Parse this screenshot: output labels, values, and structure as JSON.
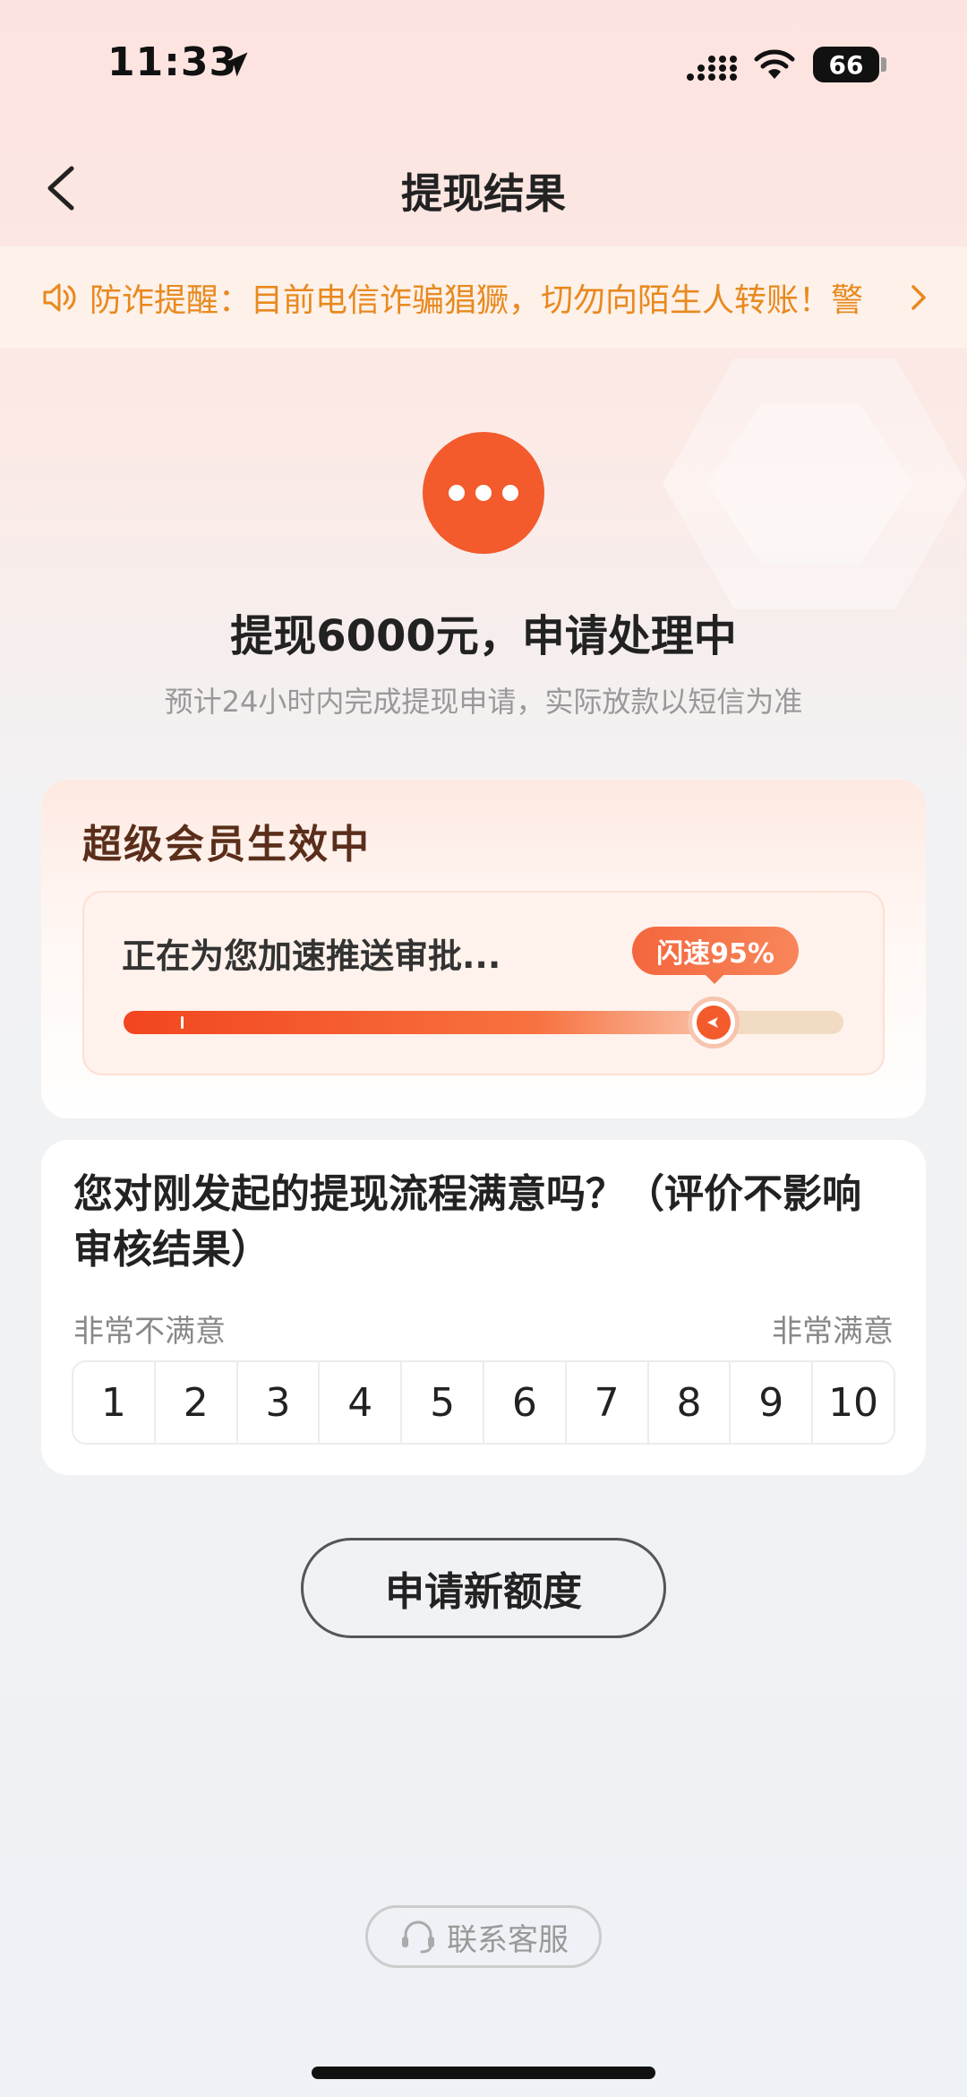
{
  "status_bar": {
    "time": "11:33",
    "battery": "66"
  },
  "nav": {
    "title": "提现结果"
  },
  "notice": {
    "text": "防诈提醒：目前电信诈骗猖獗，切勿向陌生人转账！警"
  },
  "result": {
    "title": "提现6000元，申请处理中",
    "subtitle": "预计24小时内完成提现申请，实际放款以短信为准"
  },
  "member": {
    "title": "超级会员生效中",
    "push_text": "正在为您加速推送审批...",
    "badge": "闪速95%",
    "progress": 0.82
  },
  "survey": {
    "question": "您对刚发起的提现流程满意吗？（评价不影响审核结果）",
    "label_left": "非常不满意",
    "label_right": "非常满意",
    "scale": [
      "1",
      "2",
      "3",
      "4",
      "5",
      "6",
      "7",
      "8",
      "9",
      "10"
    ]
  },
  "actions": {
    "apply_label": "申请新额度",
    "contact_label": "联系客服"
  },
  "colors": {
    "accent": "#f35a2c",
    "notice_text": "#e8891f"
  }
}
